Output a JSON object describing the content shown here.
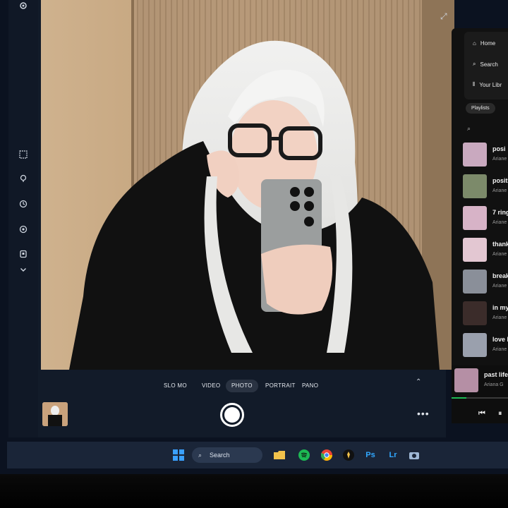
{
  "camera": {
    "modes": [
      "SLO MO",
      "VIDEO",
      "PHOTO",
      "PORTRAIT",
      "PANO"
    ],
    "active_mode": "PHOTO",
    "toolbar_icons": [
      "grid-icon",
      "location-icon",
      "timer-icon",
      "settings-icon",
      "ratio-icon",
      "chevron-down-icon"
    ]
  },
  "spotify": {
    "nav": {
      "home": "Home",
      "search": "Search",
      "library": "Your Libr"
    },
    "chip_label": "Playlists",
    "tracks": [
      {
        "title": "posi",
        "artist": "Ariane",
        "color": "#c9a9bf"
      },
      {
        "title": "positi",
        "artist": "Ariane",
        "color": "#7c8a6a"
      },
      {
        "title": "7 ring",
        "artist": "Ariane",
        "color": "#d7b3c7"
      },
      {
        "title": "thank",
        "artist": "Ariane",
        "color": "#e3c7d2"
      },
      {
        "title": "break",
        "artist": "Ariane",
        "color": "#8a8f99"
      },
      {
        "title": "in my",
        "artist": "Ariane",
        "color": "#3b2c2a"
      },
      {
        "title": "love la",
        "artist": "Ariane",
        "color": "#9aa0ad"
      }
    ],
    "now_playing": {
      "title": "past life",
      "artist": "Ariana G",
      "color": "#b58fa5"
    },
    "progress": 0.26
  },
  "taskbar": {
    "search_placeholder": "Search",
    "apps": [
      "windows-start-icon",
      "file-explorer-icon",
      "spotify-icon",
      "chrome-icon",
      "app-icon",
      "photoshop-icon",
      "lightroom-icon",
      "camera-icon"
    ],
    "ps_label": "Ps",
    "lr_label": "Lr"
  },
  "colors": {
    "spotify_green": "#1db954",
    "windows_blue": "#3aa0ff"
  }
}
